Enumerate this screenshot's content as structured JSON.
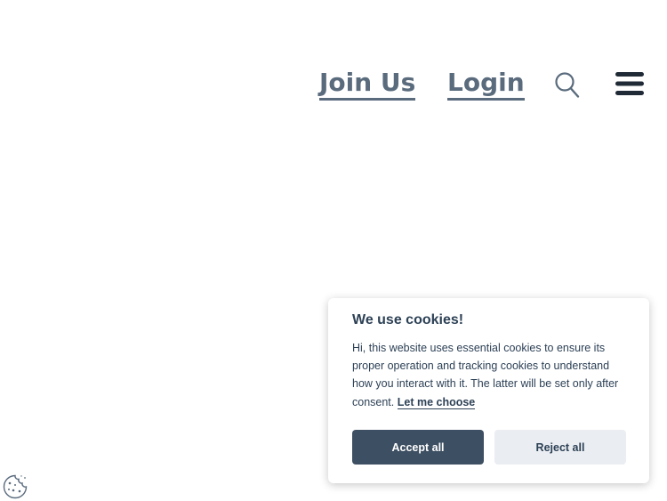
{
  "nav": {
    "join_label": "Join Us",
    "login_label": "Login",
    "search_icon": "search-icon",
    "menu_icon": "hamburger-menu-icon"
  },
  "cookie_banner": {
    "title": "We use cookies!",
    "body": "Hi, this website uses essential cookies to ensure its proper operation and tracking cookies to understand how you interact with it. The latter will be set only after consent. ",
    "choose_link": "Let me choose",
    "accept_label": "Accept all",
    "reject_label": "Reject all"
  },
  "cookie_settings_icon": "cookie-icon",
  "colors": {
    "nav_link": "#5a6b7d",
    "banner_text": "#2d4156",
    "accept_bg": "#3d4f62",
    "reject_bg": "#eaedf1"
  }
}
